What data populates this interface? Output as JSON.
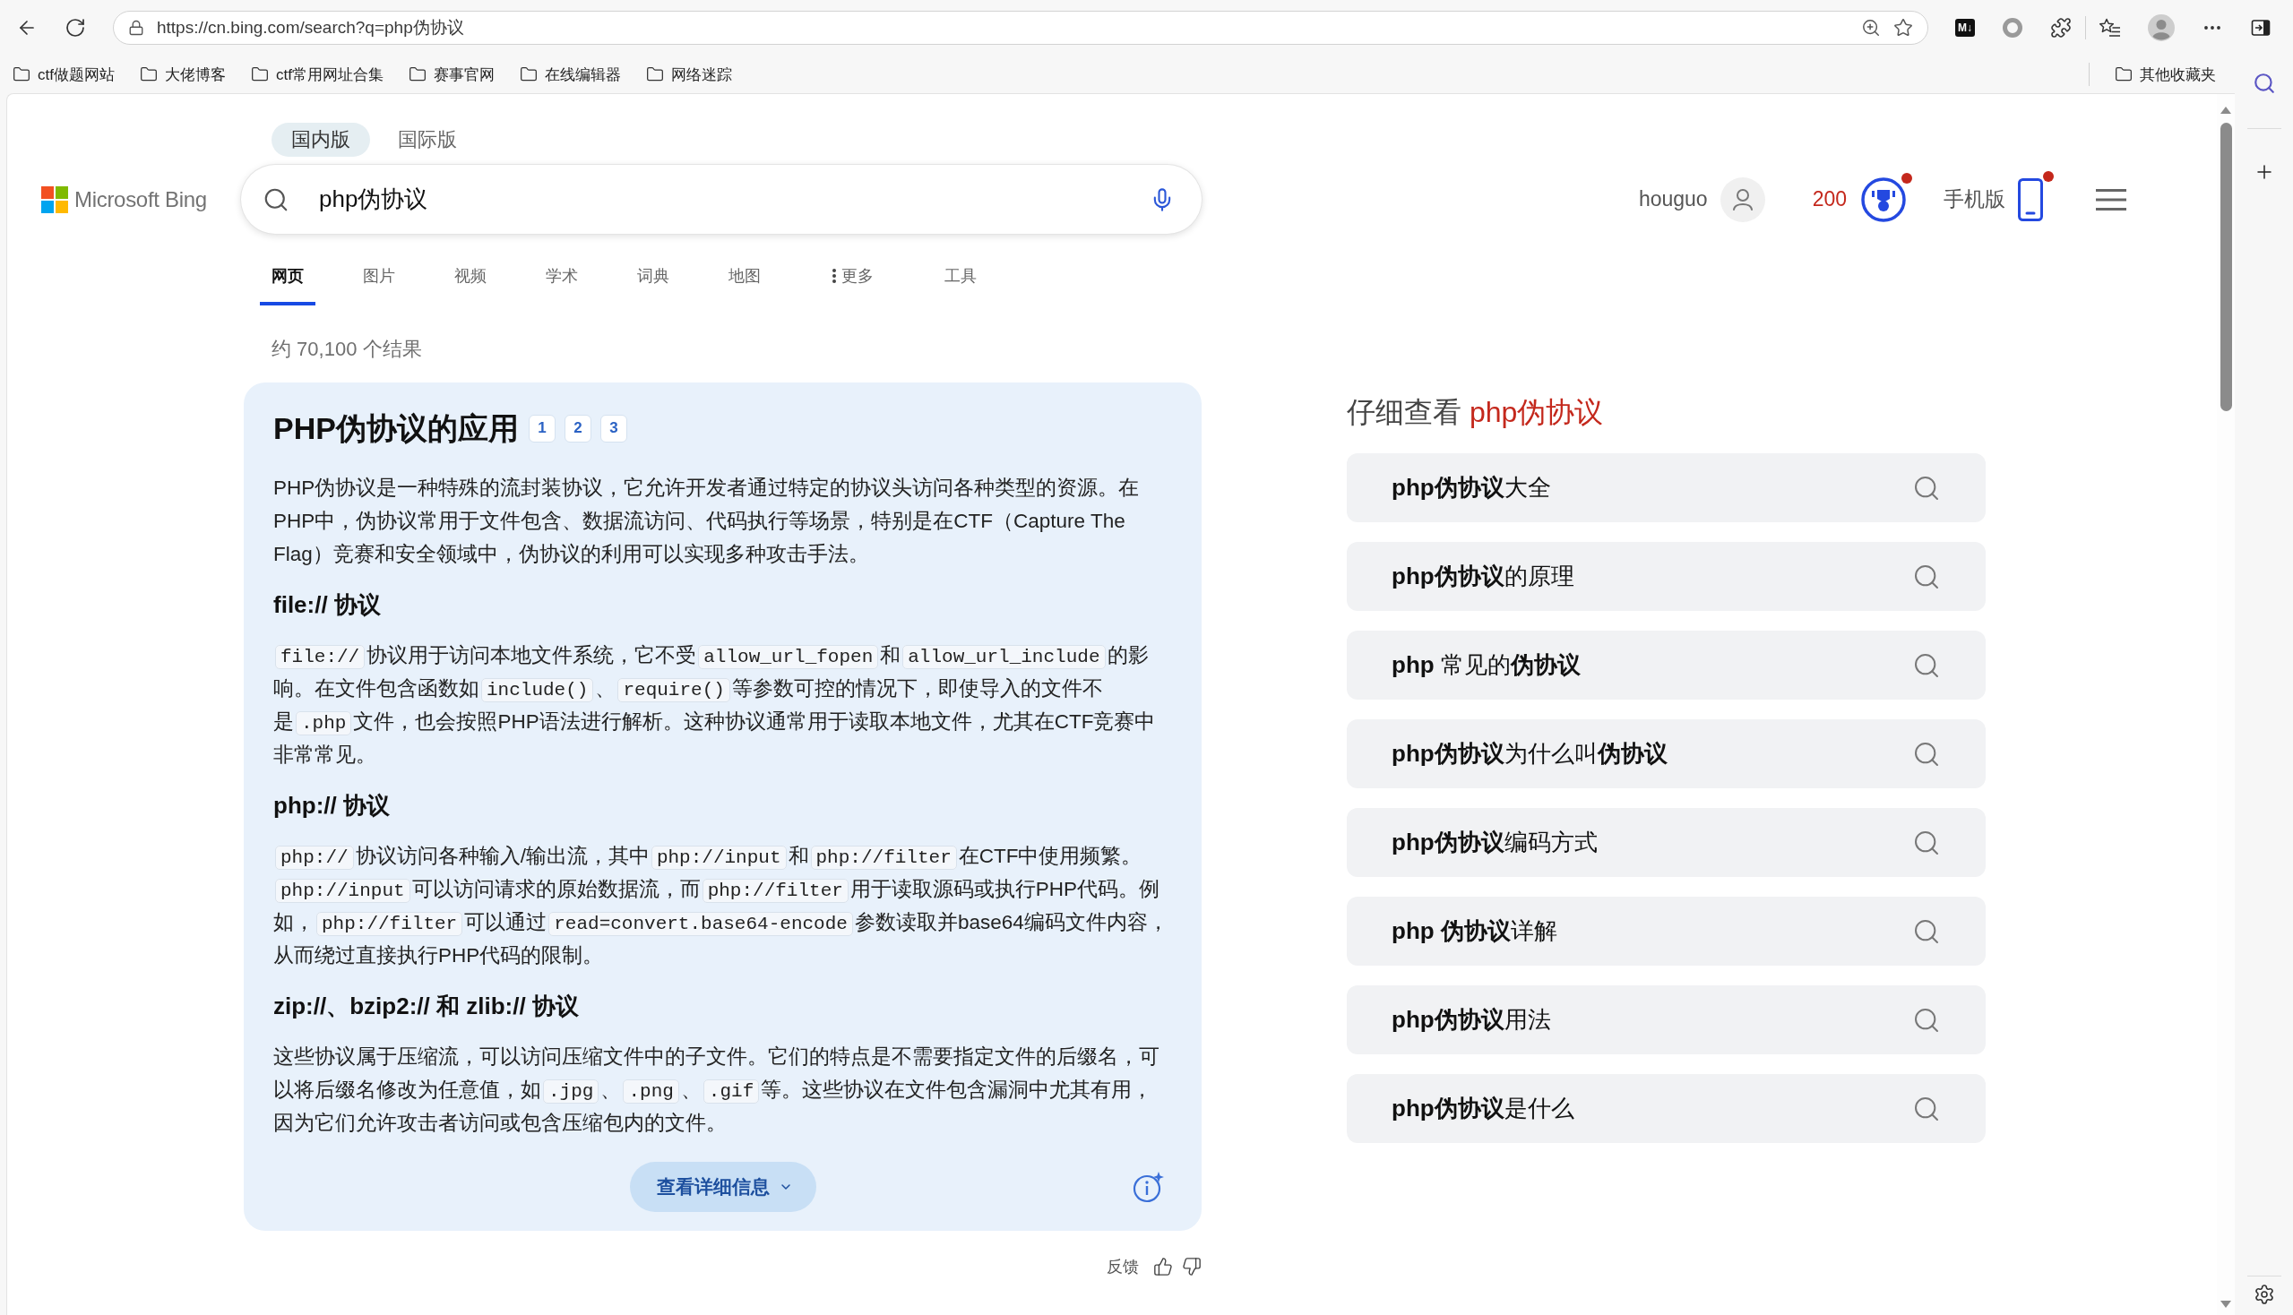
{
  "browser": {
    "url": "https://cn.bing.com/search?q=php伪协议",
    "extension_label": "M↓",
    "bookmarks": [
      "ctf做题网站",
      "大佬博客",
      "ctf常用网址合集",
      "赛事官网",
      "在线编辑器",
      "网络迷踪"
    ],
    "other_bookmarks": "其他收藏夹"
  },
  "header": {
    "region_tabs": [
      {
        "label": "国内版",
        "selected": true
      },
      {
        "label": "国际版",
        "selected": false
      }
    ],
    "logo": "Microsoft Bing",
    "search": {
      "value": "php伪协议"
    },
    "account": {
      "name": "houguo"
    },
    "rewards": {
      "points": "200",
      "notification": true
    },
    "mobile": {
      "label": "手机版",
      "notification": true
    }
  },
  "nav_tabs": [
    {
      "label": "网页",
      "selected": true,
      "kind": "link"
    },
    {
      "label": "图片",
      "selected": false,
      "kind": "link"
    },
    {
      "label": "视频",
      "selected": false,
      "kind": "link"
    },
    {
      "label": "学术",
      "selected": false,
      "kind": "link"
    },
    {
      "label": "词典",
      "selected": false,
      "kind": "link"
    },
    {
      "label": "地图",
      "selected": false,
      "kind": "link"
    },
    {
      "label": "更多",
      "selected": false,
      "kind": "menu"
    },
    {
      "label": "工具",
      "selected": false,
      "kind": "link"
    }
  ],
  "result_count": "约 70,100 个结果",
  "answer_card": {
    "title": "PHP伪协议的应用",
    "citations": [
      "1",
      "2",
      "3"
    ],
    "blocks": [
      {
        "kind": "paragraph",
        "segments": [
          {
            "kind": "text",
            "text": "PHP伪协议是一种特殊的流封装协议，它允许开发者通过特定的协议头访问各种类型的资源。在PHP中，伪协议常用于文件包含、数据流访问、代码执行等场景，特别是在CTF（Capture The Flag）竞赛和安全领域中，伪协议的利用可以实现多种攻击手法。"
          }
        ]
      },
      {
        "kind": "heading",
        "text": "file:// 协议"
      },
      {
        "kind": "paragraph",
        "segments": [
          {
            "kind": "code",
            "text": "file://"
          },
          {
            "kind": "text",
            "text": "协议用于访问本地文件系统，它不受"
          },
          {
            "kind": "code",
            "text": "allow_url_fopen"
          },
          {
            "kind": "text",
            "text": "和"
          },
          {
            "kind": "code",
            "text": "allow_url_include"
          },
          {
            "kind": "text",
            "text": "的影响。在文件包含函数如"
          },
          {
            "kind": "code",
            "text": "include()"
          },
          {
            "kind": "text",
            "text": "、"
          },
          {
            "kind": "code",
            "text": "require()"
          },
          {
            "kind": "text",
            "text": "等参数可控的情况下，即使导入的文件不是"
          },
          {
            "kind": "code",
            "text": ".php"
          },
          {
            "kind": "text",
            "text": "文件，也会按照PHP语法进行解析。这种协议通常用于读取本地文件，尤其在CTF竞赛中非常常见。"
          }
        ]
      },
      {
        "kind": "heading",
        "text": "php:// 协议"
      },
      {
        "kind": "paragraph",
        "segments": [
          {
            "kind": "code",
            "text": "php://"
          },
          {
            "kind": "text",
            "text": "协议访问各种输入/输出流，其中"
          },
          {
            "kind": "code",
            "text": "php://input"
          },
          {
            "kind": "text",
            "text": "和"
          },
          {
            "kind": "code",
            "text": "php://filter"
          },
          {
            "kind": "text",
            "text": "在CTF中使用频繁。"
          },
          {
            "kind": "code",
            "text": "php://input"
          },
          {
            "kind": "text",
            "text": "可以访问请求的原始数据流，而"
          },
          {
            "kind": "code",
            "text": "php://filter"
          },
          {
            "kind": "text",
            "text": "用于读取源码或执行PHP代码。例如，"
          },
          {
            "kind": "code",
            "text": "php://filter"
          },
          {
            "kind": "text",
            "text": "可以通过"
          },
          {
            "kind": "code",
            "text": "read=convert.base64-encode"
          },
          {
            "kind": "text",
            "text": "参数读取并base64编码文件内容，从而绕过直接执行PHP代码的限制。"
          }
        ]
      },
      {
        "kind": "heading",
        "text": "zip://、bzip2:// 和 zlib:// 协议"
      },
      {
        "kind": "paragraph",
        "segments": [
          {
            "kind": "text",
            "text": "这些协议属于压缩流，可以访问压缩文件中的子文件。它们的特点是不需要指定文件的后缀名，可以将后缀名修改为任意值，如"
          },
          {
            "kind": "code",
            "text": ".jpg"
          },
          {
            "kind": "text",
            "text": "、"
          },
          {
            "kind": "code",
            "text": ".png"
          },
          {
            "kind": "text",
            "text": "、"
          },
          {
            "kind": "code",
            "text": ".gif"
          },
          {
            "kind": "text",
            "text": "等。这些协议在文件包含漏洞中尤其有用，因为它们允许攻击者访问或包含压缩包内的文件。"
          }
        ]
      }
    ],
    "more_button": "查看详细信息"
  },
  "feedback": {
    "label": "反馈"
  },
  "related": {
    "title": "仔细查看",
    "query": "php伪协议",
    "items": [
      "**php伪协议**大全",
      "**php伪协议**的原理",
      "**php** 常见的**伪协议**",
      "**php伪协议**为什么叫**伪协议**",
      "**php伪协议**编码方式",
      "**php 伪协议**详解",
      "**php伪协议**用法",
      "**php伪协议**是什么"
    ]
  }
}
